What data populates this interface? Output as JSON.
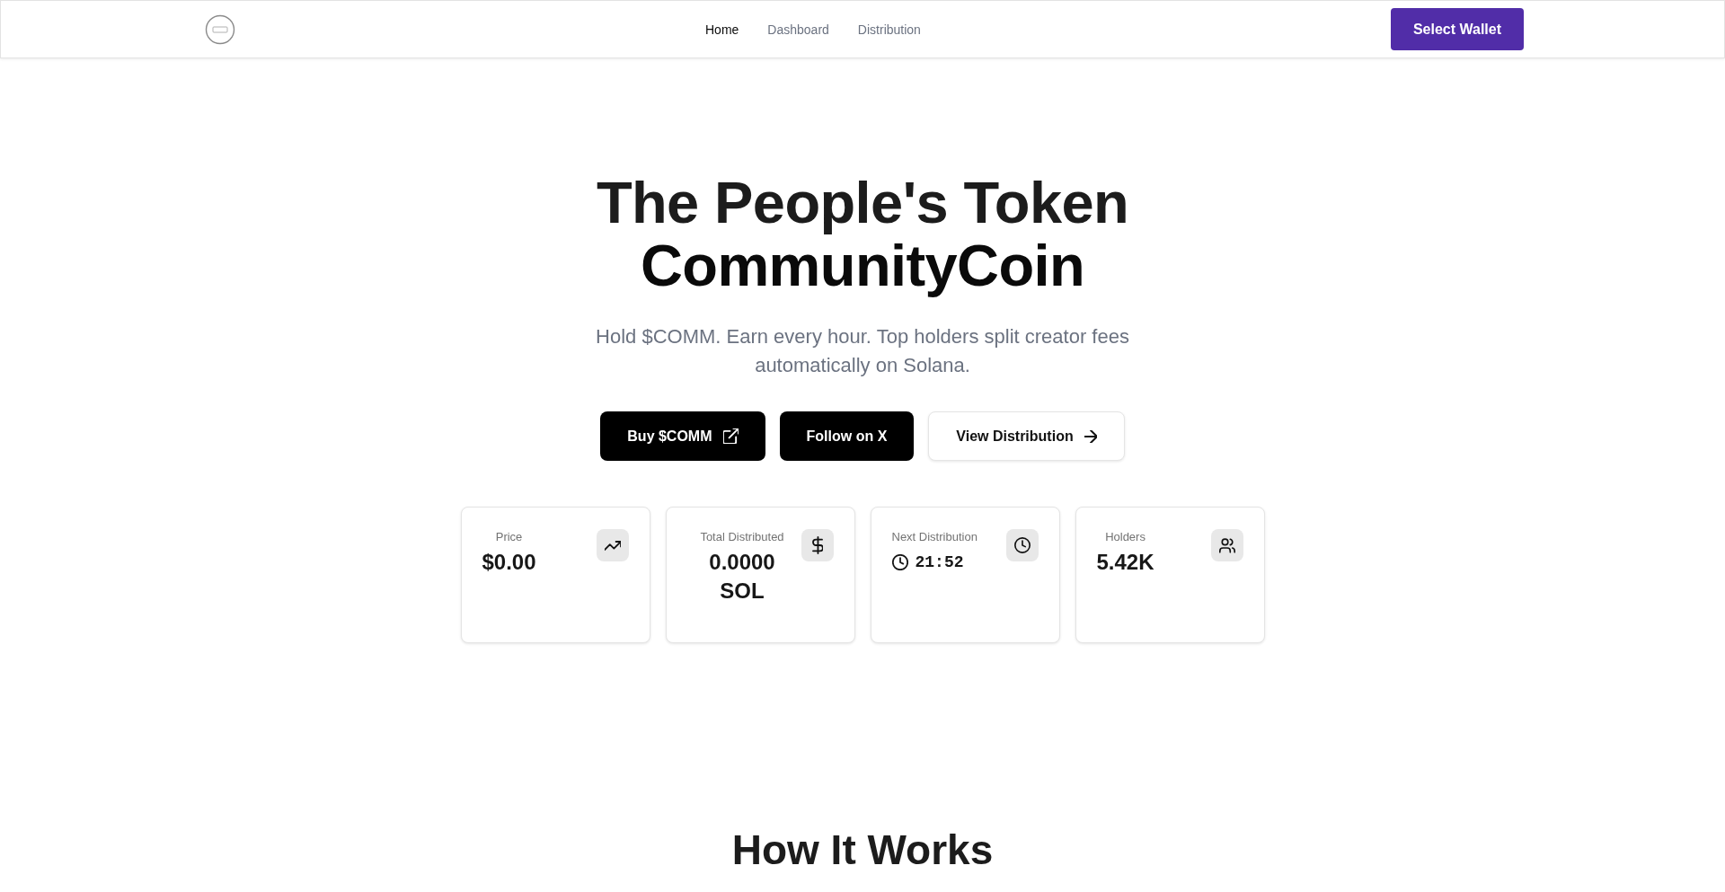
{
  "header": {
    "nav": [
      {
        "label": "Home",
        "selected": true
      },
      {
        "label": "Dashboard",
        "selected": false
      },
      {
        "label": "Distribution",
        "selected": false
      }
    ],
    "wallet_button": "Select Wallet"
  },
  "hero": {
    "title_lines": [
      "The People's Token",
      "CommunityCoin"
    ],
    "subtitle": "Hold $COMM. Earn every hour. Top holders split creator fees automatically on Solana.",
    "buttons": [
      {
        "label": "Buy $COMM",
        "kind": "external"
      },
      {
        "label": "Follow on X",
        "kind": "plain"
      },
      {
        "label": "View Distribution",
        "kind": "next"
      }
    ]
  },
  "stats": [
    {
      "label": "Price",
      "value": "$0.00",
      "kind": "price"
    },
    {
      "label": "Total Distributed",
      "value": "0.0000 SOL",
      "kind": "total"
    },
    {
      "label": "Next Distribution",
      "value": "21:52",
      "kind": "countdown"
    },
    {
      "label": "Holders",
      "value": "5.42K",
      "kind": "holders"
    }
  ],
  "how_it_works": {
    "title": "How It Works"
  }
}
